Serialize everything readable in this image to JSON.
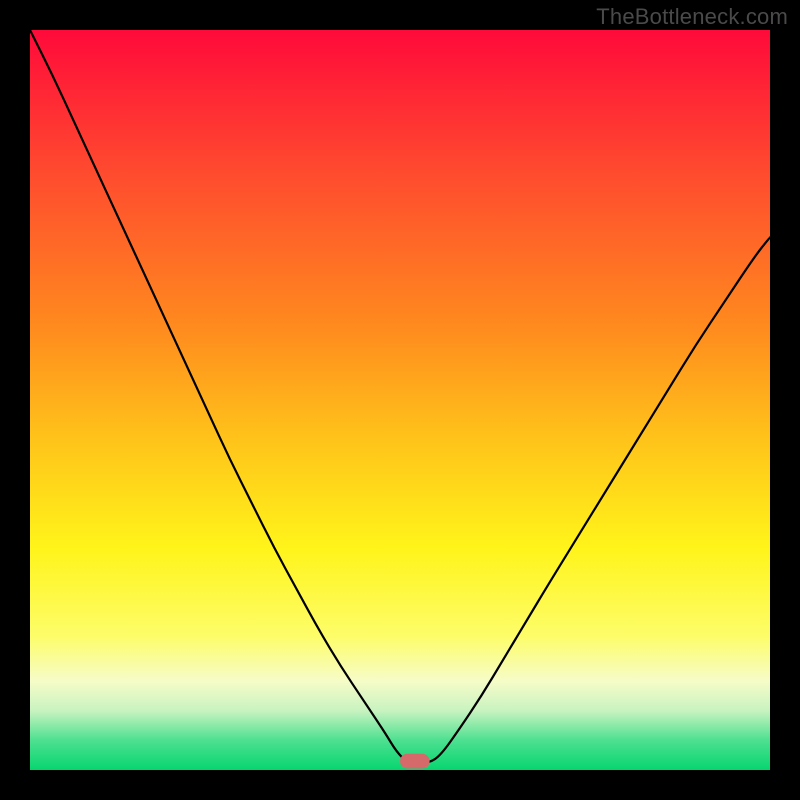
{
  "watermark": "TheBottleneck.com",
  "chart_data": {
    "type": "line",
    "title": "",
    "xlabel": "",
    "ylabel": "",
    "xlim": [
      0,
      100
    ],
    "ylim": [
      0,
      100
    ],
    "grid": false,
    "legend": false,
    "background": {
      "type": "vertical-gradient",
      "stops": [
        {
          "pos": 0.0,
          "color": "#ff0a3a"
        },
        {
          "pos": 0.2,
          "color": "#ff4d2e"
        },
        {
          "pos": 0.4,
          "color": "#ff8a1e"
        },
        {
          "pos": 0.55,
          "color": "#ffc21a"
        },
        {
          "pos": 0.7,
          "color": "#fff41a"
        },
        {
          "pos": 0.82,
          "color": "#fdfd6a"
        },
        {
          "pos": 0.88,
          "color": "#f6fcc8"
        },
        {
          "pos": 0.92,
          "color": "#c8f3c0"
        },
        {
          "pos": 0.96,
          "color": "#4de090"
        },
        {
          "pos": 1.0,
          "color": "#06d66f"
        }
      ]
    },
    "series": [
      {
        "name": "bottleneck-curve",
        "color": "#000000",
        "width": 2.2,
        "x": [
          0.0,
          3.0,
          6.0,
          9.0,
          12.0,
          15.0,
          18.0,
          21.0,
          24.0,
          27.0,
          30.0,
          33.0,
          36.0,
          39.0,
          42.0,
          45.0,
          48.0,
          49.5,
          51.0,
          52.5,
          54.0,
          55.5,
          58.0,
          61.0,
          64.0,
          67.0,
          70.0,
          74.0,
          78.0,
          82.0,
          86.0,
          90.0,
          94.0,
          98.0,
          100.0
        ],
        "y": [
          100.0,
          94.0,
          87.5,
          81.0,
          74.5,
          68.0,
          61.5,
          55.0,
          48.5,
          42.0,
          36.0,
          30.0,
          24.5,
          19.0,
          14.0,
          9.5,
          5.0,
          2.5,
          1.0,
          1.0,
          1.0,
          2.0,
          5.5,
          10.0,
          15.0,
          20.0,
          25.0,
          31.5,
          38.0,
          44.5,
          51.0,
          57.5,
          63.5,
          69.5,
          72.0
        ]
      }
    ],
    "marker": {
      "name": "optimal-point",
      "color": "#d66a6a",
      "shape": "capsule",
      "x": 52.0,
      "y": 1.2,
      "rx": 2.0,
      "ry": 1.0
    }
  }
}
